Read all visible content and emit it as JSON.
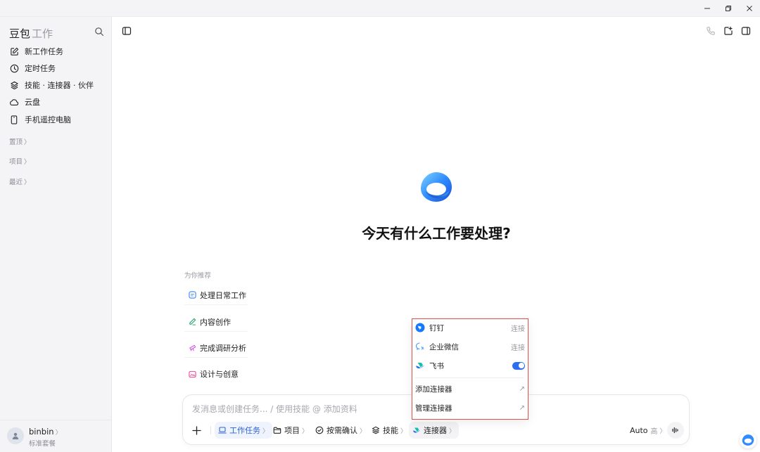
{
  "sidebar": {
    "brand": "豆包",
    "brand_sub": "工作",
    "items": [
      {
        "label": "新工作任务",
        "icon": "edit-icon"
      },
      {
        "label": "定时任务",
        "icon": "clock-icon"
      },
      {
        "label": "技能 · 连接器 · 伙伴",
        "icon": "layers-icon"
      },
      {
        "label": "云盘",
        "icon": "cloud-icon"
      },
      {
        "label": "手机遥控电脑",
        "icon": "phone-icon"
      }
    ],
    "sections": [
      {
        "label": "置顶",
        "chevron": "〉"
      },
      {
        "label": "项目",
        "chevron": "〉"
      },
      {
        "label": "最近",
        "chevron": "〉"
      }
    ],
    "user": {
      "name": "binbin",
      "chevron": "〉",
      "plan": "标准套餐"
    }
  },
  "main": {
    "title": "今天有什么工作要处理?",
    "recommend_title": "为你推荐",
    "recommendations": [
      {
        "label": "处理日常工作",
        "icon": "chat-icon",
        "color": "#3b82f6"
      },
      {
        "label": "内容创作",
        "icon": "pen-icon",
        "color": "#22a06b"
      },
      {
        "label": "完成调研分析",
        "icon": "telescope-icon",
        "color": "#d946ef"
      },
      {
        "label": "设计与创意",
        "icon": "image-icon",
        "color": "#ec4899"
      }
    ]
  },
  "composer": {
    "placeholder": "发消息或创建任务... / 使用技能 @ 添加资料",
    "tools": [
      {
        "label": "工作任务",
        "chevron": "〉",
        "icon": "laptop-icon"
      },
      {
        "label": "项目",
        "chevron": "〉",
        "icon": "folder-icon"
      },
      {
        "label": "按需确认",
        "chevron": "〉",
        "icon": "check-circle-icon"
      },
      {
        "label": "技能",
        "chevron": "〉",
        "icon": "layers-icon"
      },
      {
        "label": "连接器",
        "chevron": "〉",
        "icon": "feishu-icon"
      }
    ],
    "model": "Auto",
    "level": "高",
    "level_chevron": "〉"
  },
  "connectors_popup": {
    "items": [
      {
        "label": "钉钉",
        "action": "连接",
        "icon": "dingtalk-icon"
      },
      {
        "label": "企业微信",
        "action": "连接",
        "icon": "wecom-icon"
      },
      {
        "label": "飞书",
        "icon": "feishu-icon",
        "enabled": true
      }
    ],
    "links": [
      {
        "label": "添加连接器",
        "arrow": "↗"
      },
      {
        "label": "管理连接器",
        "arrow": "↗"
      }
    ]
  },
  "colors": {
    "accent": "#2b6ff0",
    "popup_border": "#e2504c",
    "sidebar_bg": "#f4f4f6"
  }
}
